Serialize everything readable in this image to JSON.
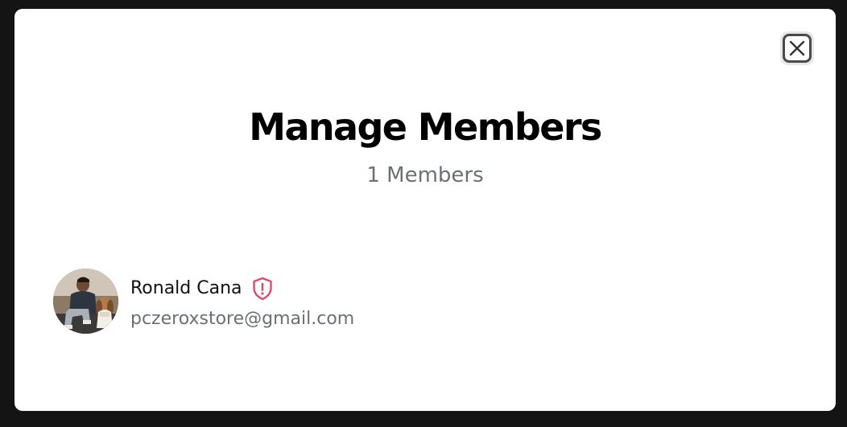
{
  "modal": {
    "title": "Manage Members",
    "subtitle": "1 Members",
    "close_icon": "close-icon"
  },
  "members": [
    {
      "name": "Ronald Cana",
      "email": "pczeroxstore@gmail.com",
      "role_icon": "shield-alert-icon",
      "role_icon_color": "#e5486a"
    }
  ],
  "colors": {
    "backdrop": "#141414",
    "surface": "#ffffff",
    "title": "#000000",
    "muted_text": "#6b6f76"
  }
}
